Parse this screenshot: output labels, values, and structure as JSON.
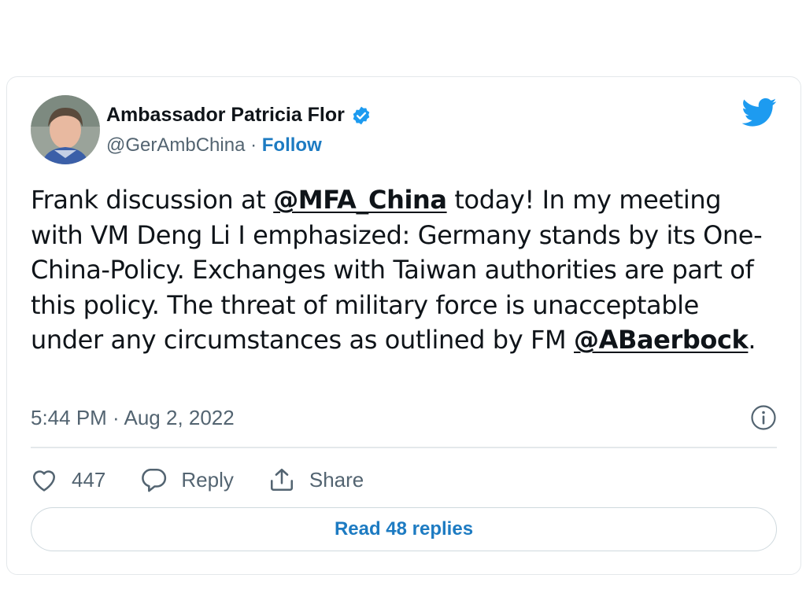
{
  "tweet": {
    "author_name": "Ambassador Patricia Flor",
    "handle": "@GerAmbChina",
    "separator": " · ",
    "follow_label": "Follow",
    "text_parts": {
      "p1": "Frank discussion at ",
      "m1": "@MFA_China",
      "p2": " today! In my meeting with VM Deng Li I emphasized: Germany stands by its One-China-Policy. Exchanges with Taiwan authorities are part of this policy. The threat of military force is unacceptable under any circumstances as outlined by FM ",
      "m2": "@ABaerbock",
      "p3": "."
    },
    "timestamp": "5:44 PM · Aug 2, 2022",
    "likes": "447",
    "reply_label": "Reply",
    "share_label": "Share",
    "read_replies_label": "Read 48 replies"
  },
  "icons": {
    "verified": "verified-badge-icon",
    "brand": "twitter-bird-icon",
    "info": "info-icon",
    "like": "heart-icon",
    "reply": "reply-icon",
    "share": "share-icon"
  },
  "colors": {
    "brand": "#1d9bf0",
    "link": "#1d7bc2",
    "text": "#0f1419",
    "muted": "#536471",
    "border": "#e4e8eb"
  }
}
